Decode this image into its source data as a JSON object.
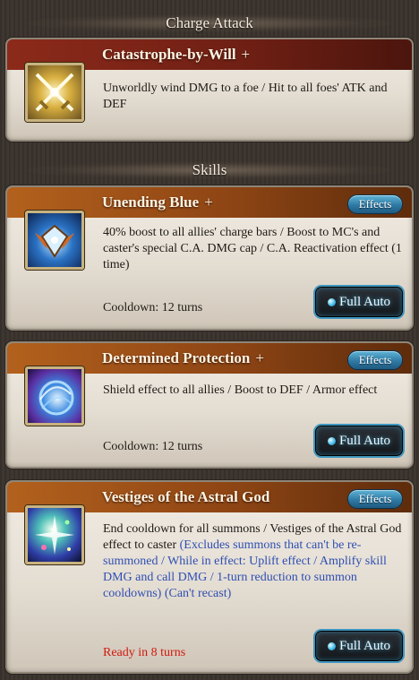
{
  "charge_attack": {
    "header": "Charge Attack",
    "name": "Catastrophe-by-Will",
    "plus": "+",
    "icon": "crossed-swords-icon",
    "description": "Unworldly wind DMG to a foe / Hit to all foes' ATK and DEF"
  },
  "skills": {
    "header": "Skills",
    "effects_label": "Effects",
    "full_auto_label": "Full Auto",
    "items": [
      {
        "name": "Unending Blue",
        "plus": "+",
        "icon": "blue-crest-icon",
        "description": "40% boost to all allies' charge bars / Boost to MC's and caster's special C.A. DMG cap / C.A. Reactivation effect (1 time)",
        "note": "",
        "cooldown": "Cooldown: 12 turns"
      },
      {
        "name": "Determined Protection",
        "plus": "+",
        "icon": "blue-shield-orb-icon",
        "description": "Shield effect to all allies / Boost to DEF / Armor effect",
        "note": "",
        "cooldown": "Cooldown: 12 turns"
      },
      {
        "name": "Vestiges of the Astral God",
        "plus": "",
        "icon": "astral-sparkle-icon",
        "description": "End cooldown for all summons / Vestiges of the Astral God effect to caster",
        "note": "(Excludes summons that can't be re-summoned / While in effect: Uplift effect / Amplify skill DMG and call DMG / 1-turn reduction to summon cooldowns) (Can't recast)",
        "cooldown": "Ready in 8 turns"
      }
    ]
  },
  "colors": {
    "ready_text": "#d2190f",
    "note_text": "#2f4fb3",
    "charge_title_bar": "#8c2a1a",
    "skill_title_bar": "#b3611d"
  }
}
